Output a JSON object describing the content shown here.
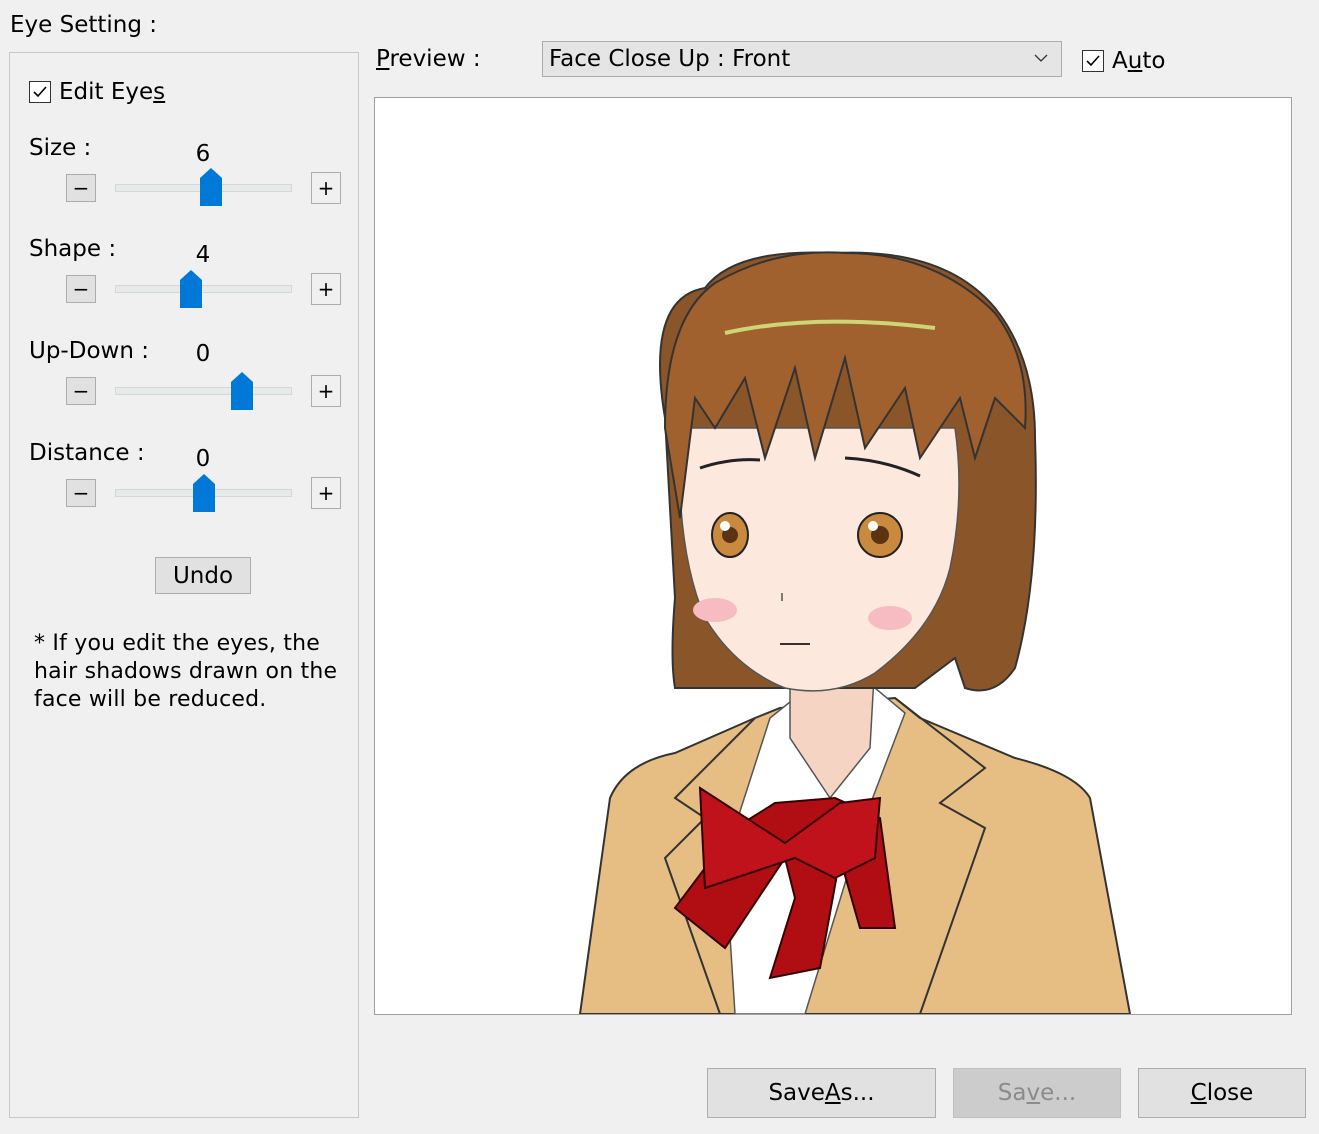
{
  "window": {
    "title": "Eye Setting :"
  },
  "left_panel": {
    "edit_eyes_checkbox": {
      "label_pre": "Edit Eye",
      "label_ul": "s",
      "checked": true
    },
    "sliders": [
      {
        "label": "Size :",
        "value": "6",
        "level": 0.55
      },
      {
        "label": "Shape :",
        "value": "4",
        "level": 0.43
      },
      {
        "label": "Up-Down :",
        "value": "0",
        "level": 0.72
      },
      {
        "label": "Distance :",
        "value": "0",
        "level": 0.5
      }
    ],
    "minus_glyph": "−",
    "plus_glyph": "+",
    "undo_label": "Undo",
    "note": "* If you edit the eyes, the hair shadows drawn on the face will be reduced.",
    "note_lines": [
      "* If you edit the eyes, the",
      "hair shadows drawn on the",
      "face will be reduced."
    ]
  },
  "preview": {
    "label_ul": "P",
    "label_rest": "review :",
    "dropdown_value": "Face Close Up : Front",
    "auto_checkbox": {
      "label_pre": "A",
      "label_ul": "u",
      "label_post": "to",
      "checked": true
    }
  },
  "footer": {
    "save_as": {
      "pre": "Save ",
      "ul": "A",
      "post": "s..."
    },
    "save": {
      "pre": "Sa",
      "ul": "v",
      "post": "e..."
    },
    "close": {
      "ul": "C",
      "post": "lose"
    }
  },
  "colors": {
    "accent": "#0078d7",
    "hair": "#a0612e",
    "jacket": "#e6bd83",
    "bow": "#b00e12"
  }
}
